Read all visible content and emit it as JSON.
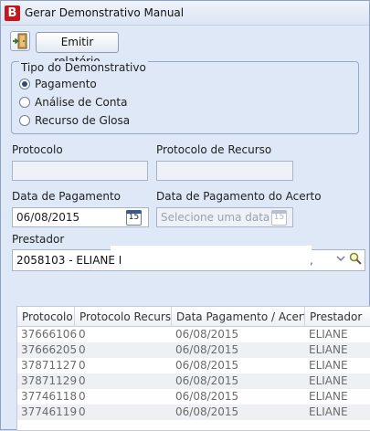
{
  "window": {
    "title": "Gerar Demonstrativo Manual",
    "app_icon_letter": "B"
  },
  "toolbar": {
    "emit_label": "Emitir relatório"
  },
  "tipo": {
    "legend": "Tipo do Demonstrativo",
    "options": [
      {
        "label": "Pagamento",
        "selected": true
      },
      {
        "label": "Análise de Conta",
        "selected": false
      },
      {
        "label": "Recurso de Glosa",
        "selected": false
      }
    ]
  },
  "form": {
    "protocolo_label": "Protocolo",
    "protocolo_value": "",
    "protocolo_recurso_label": "Protocolo de Recurso",
    "protocolo_recurso_value": "",
    "data_pagamento_label": "Data de Pagamento",
    "data_pagamento_value": "06/08/2015",
    "data_acerto_label": "Data de Pagamento do Acerto",
    "data_acerto_placeholder": "Selecione uma data",
    "calendar_day": "15",
    "prestador_label": "Prestador",
    "prestador_value": "2058103 - ELIANE I"
  },
  "grid": {
    "columns": [
      "Protocolo",
      "Protocolo Recurso",
      "Data Pagamento / Acerto",
      "Prestador"
    ],
    "rows": [
      [
        "37666106",
        "0",
        "06/08/2015",
        "ELIANE"
      ],
      [
        "37666205",
        "0",
        "06/08/2015",
        "ELIANE"
      ],
      [
        "37871127",
        "0",
        "06/08/2015",
        "ELIANE"
      ],
      [
        "37871129",
        "0",
        "06/08/2015",
        "ELIANE"
      ],
      [
        "37746118",
        "0",
        "06/08/2015",
        "ELIANE"
      ],
      [
        "37746119",
        "0",
        "06/08/2015",
        "ELIANE"
      ]
    ]
  },
  "colors": {
    "app_icon": "#c4161c",
    "window_bg": "#dfe8f7",
    "accent": "#3a5a8c"
  }
}
